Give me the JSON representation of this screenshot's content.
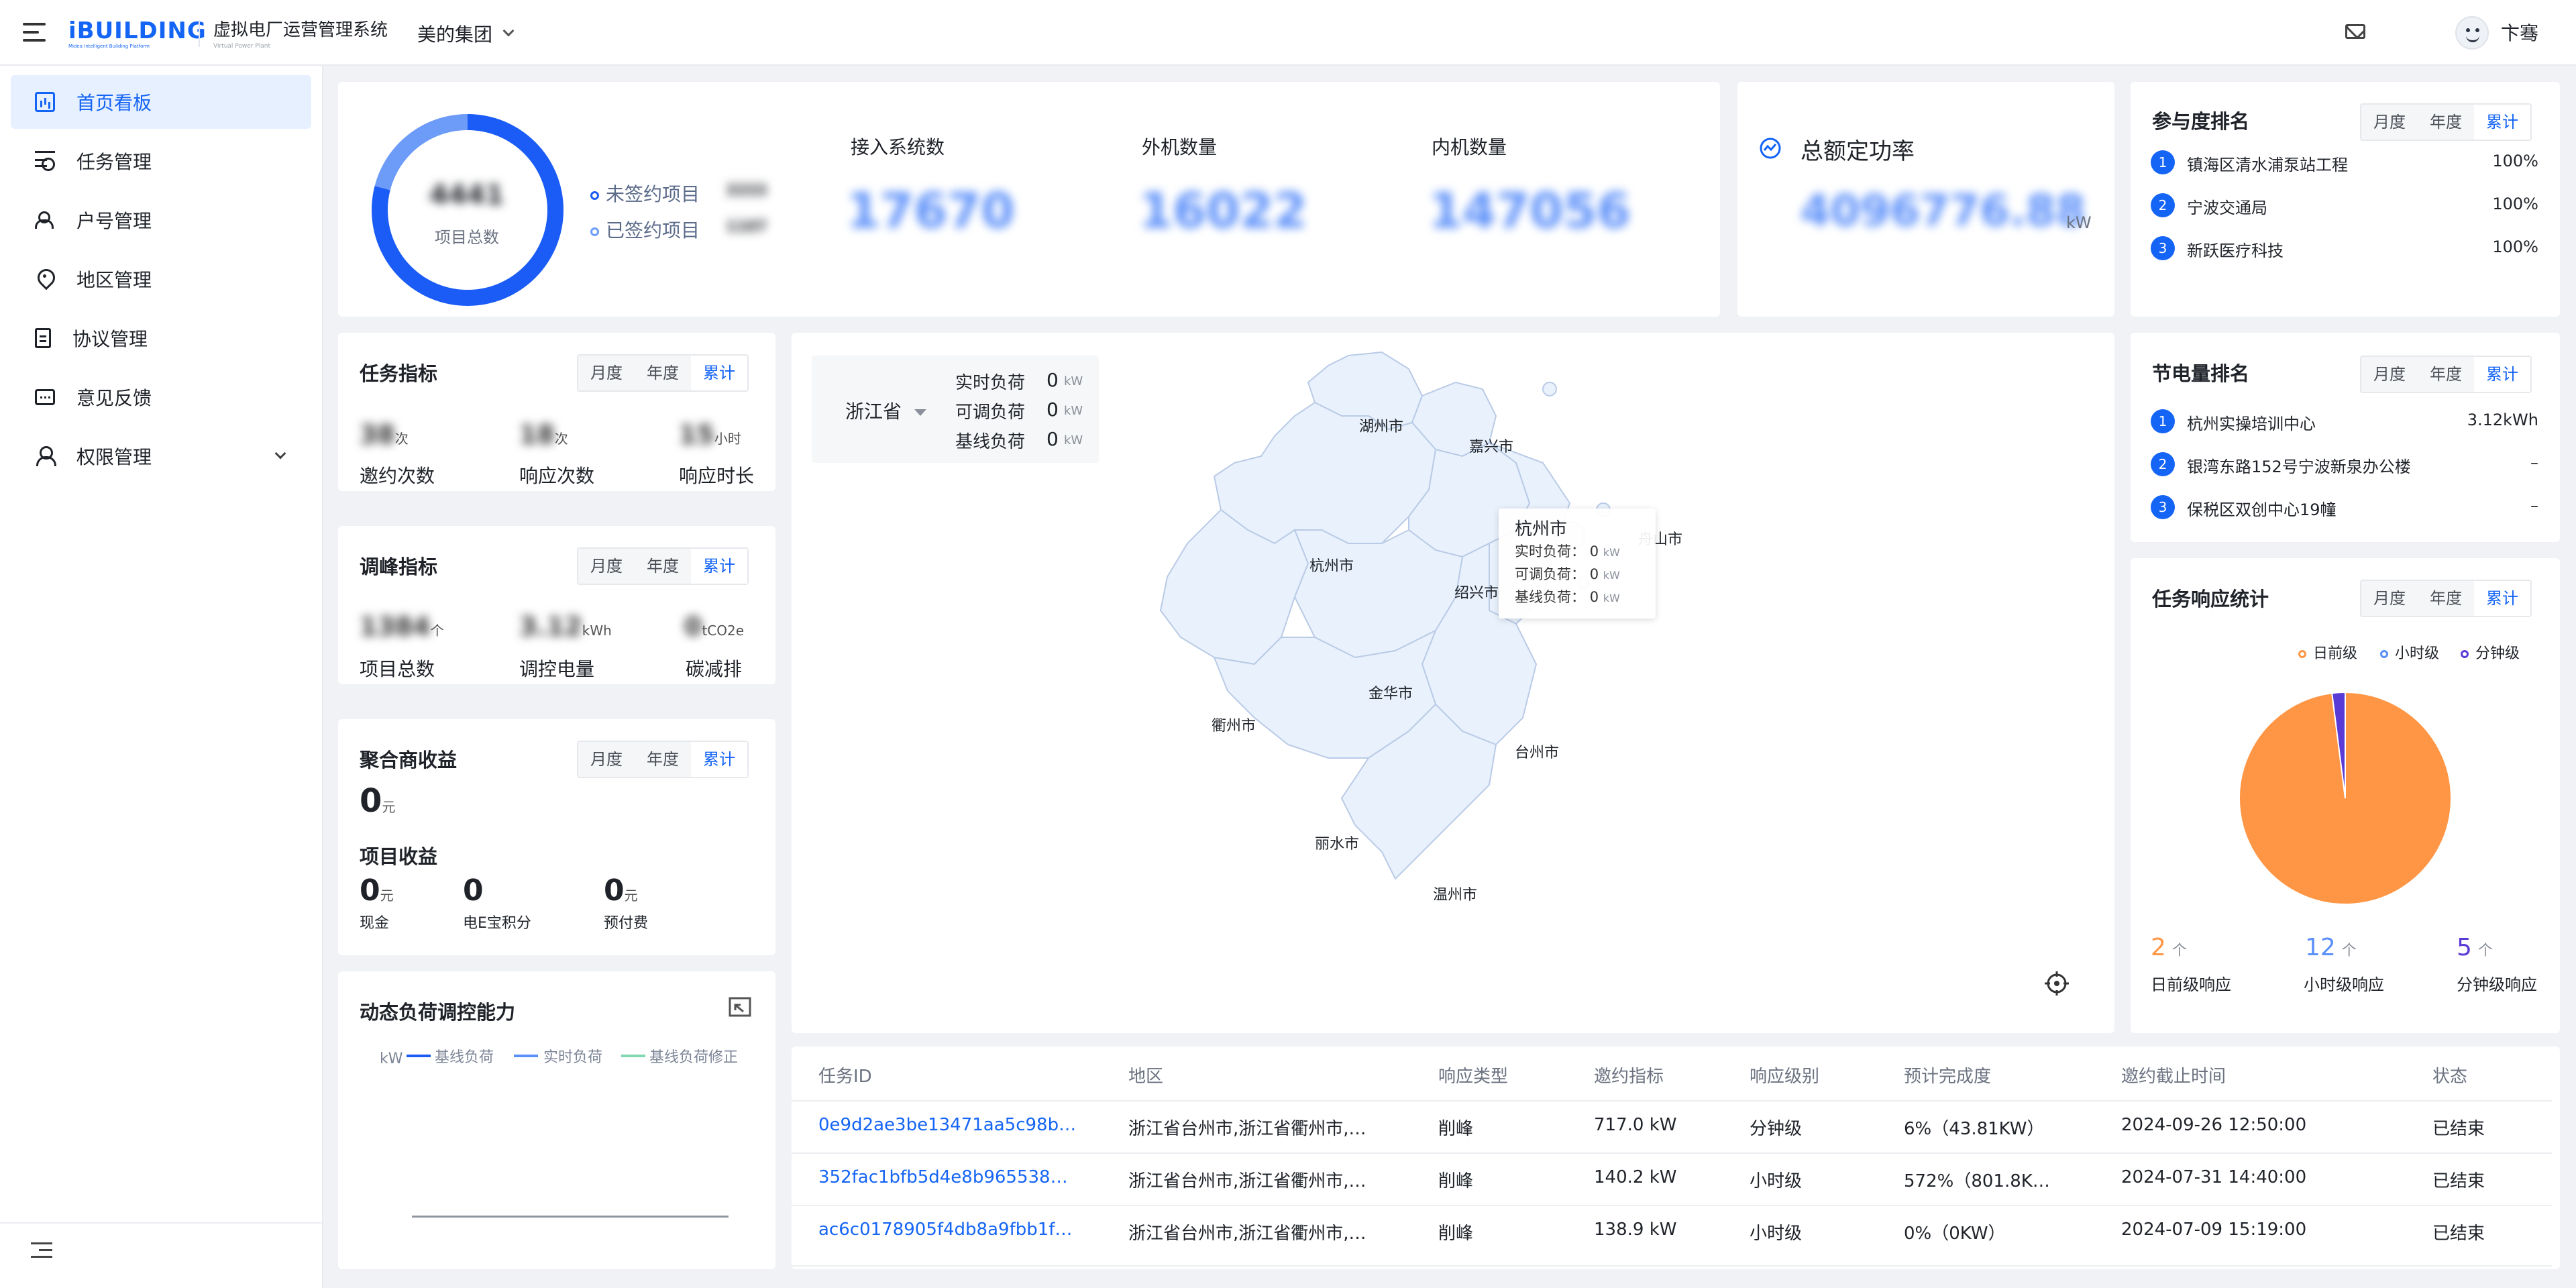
{
  "header": {
    "logo": "iBUILDING",
    "logo_tagline": "Midea Intelligent Building Platform",
    "system_name": "虚拟电厂运营管理系统",
    "system_name_en": "Virtual Power Plant",
    "group": "美的集团",
    "user": "卞骞"
  },
  "sidebar": {
    "items": [
      {
        "label": "首页看板",
        "icon": "dashboard-icon",
        "active": true
      },
      {
        "label": "任务管理",
        "icon": "task-icon"
      },
      {
        "label": "户号管理",
        "icon": "users-icon"
      },
      {
        "label": "地区管理",
        "icon": "location-pin-icon"
      },
      {
        "label": "协议管理",
        "icon": "document-icon"
      },
      {
        "label": "意见反馈",
        "icon": "feedback-icon"
      },
      {
        "label": "权限管理",
        "icon": "permission-icon"
      }
    ]
  },
  "segment": {
    "month": "月度",
    "year": "年度",
    "total": "累计"
  },
  "overview": {
    "donut_value": "4441",
    "donut_label": "项目总数",
    "unsigned_label": "未签约项目",
    "unsigned_value": "3333",
    "signed_label": "已签约项目",
    "signed_value": "1107",
    "donut_signed_fraction": 0.79,
    "stats": [
      {
        "label": "接入系统数",
        "value": "17670"
      },
      {
        "label": "外机数量",
        "value": "16022"
      },
      {
        "label": "内机数量",
        "value": "147056"
      }
    ]
  },
  "rated_power": {
    "title": "总额定功率",
    "value": "4096776.88",
    "unit": "kW"
  },
  "participation_rank": {
    "title": "参与度排名",
    "items": [
      {
        "rank": "1",
        "name": "镇海区清水浦泵站工程",
        "value": "100%"
      },
      {
        "rank": "2",
        "name": "宁波交通局",
        "value": "100%"
      },
      {
        "rank": "3",
        "name": "新跃医疗科技",
        "value": "100%"
      }
    ]
  },
  "energy_rank": {
    "title": "节电量排名",
    "items": [
      {
        "rank": "1",
        "name": "杭州实操培训中心",
        "value": "3.12kWh"
      },
      {
        "rank": "2",
        "name": "银湾东路152号宁波新泉办公楼",
        "value": "–"
      },
      {
        "rank": "3",
        "name": "保税区双创中心19幢",
        "value": "–"
      }
    ]
  },
  "task_metrics": {
    "title": "任务指标",
    "items": [
      {
        "value": "38",
        "unit": "次",
        "label": "邀约次数"
      },
      {
        "value": "18",
        "unit": "次",
        "label": "响应次数"
      },
      {
        "value": "15",
        "unit": "小时",
        "label": "响应时长"
      }
    ]
  },
  "peak_metrics": {
    "title": "调峰指标",
    "items": [
      {
        "value": "1384",
        "unit": "个",
        "label": "项目总数"
      },
      {
        "value": "3.12",
        "unit": "kWh",
        "label": "调控电量"
      },
      {
        "value": "0",
        "unit": "tCO2e",
        "label": "碳减排"
      }
    ]
  },
  "aggregator": {
    "title": "聚合商收益",
    "value": "0",
    "unit": "元",
    "project_title": "项目收益",
    "items": [
      {
        "value": "0",
        "unit": "元",
        "label": "现金"
      },
      {
        "value": "0",
        "unit": "",
        "label": "电E宝积分"
      },
      {
        "value": "0",
        "unit": "元",
        "label": "预付费"
      }
    ]
  },
  "dynamic_load": {
    "title": "动态负荷调控能力",
    "y_unit": "kW",
    "legend": [
      "基线负荷",
      "实时负荷",
      "基线负荷修正"
    ],
    "legend_colors": [
      "#1a5cf5",
      "#5b8ff9",
      "#7fd8b0"
    ]
  },
  "map": {
    "province": "浙江省",
    "realtime_label": "实时负荷",
    "adjustable_label": "可调负荷",
    "baseline_label": "基线负荷",
    "realtime": "0",
    "adjustable": "0",
    "baseline": "0",
    "unit": "kW",
    "cities": [
      "湖州市",
      "嘉兴市",
      "杭州市",
      "绍兴市",
      "舟山市",
      "衢州市",
      "金华市",
      "台州市",
      "丽水市",
      "温州市"
    ],
    "tooltip": {
      "city": "杭州市",
      "realtime": "0",
      "adjustable": "0",
      "baseline": "0"
    }
  },
  "response_stats": {
    "title": "任务响应统计",
    "legend": [
      "日前级",
      "小时级",
      "分钟级"
    ],
    "colors": [
      "#ff9645",
      "#5b8ff9",
      "#5b3bd6"
    ],
    "counts": [
      {
        "value": "2",
        "unit": "个",
        "label": "日前级响应"
      },
      {
        "value": "12",
        "unit": "个",
        "label": "小时级响应"
      },
      {
        "value": "5",
        "unit": "个",
        "label": "分钟级响应"
      }
    ],
    "chart_data": {
      "type": "pie",
      "categories": [
        "日前级",
        "小时级",
        "分钟级"
      ],
      "values": [
        98,
        0,
        2
      ]
    }
  },
  "table": {
    "headers": [
      "任务ID",
      "地区",
      "响应类型",
      "邀约指标",
      "响应级别",
      "预计完成度",
      "邀约截止时间",
      "状态"
    ],
    "rows": [
      [
        "0e9d2ae3be13471aa5c98b…",
        "浙江省台州市,浙江省衢州市,…",
        "削峰",
        "717.0 kW",
        "分钟级",
        "6%（43.81KW）",
        "2024-09-26 12:50:00",
        "已结束"
      ],
      [
        "352fac1bfb5d4e8b965538…",
        "浙江省台州市,浙江省衢州市,…",
        "削峰",
        "140.2 kW",
        "小时级",
        "572%（801.8K…",
        "2024-07-31 14:40:00",
        "已结束"
      ],
      [
        "ac6c0178905f4db8a9fbb1f…",
        "浙江省台州市,浙江省衢州市,…",
        "削峰",
        "138.9 kW",
        "小时级",
        "0%（0KW）",
        "2024-07-09 15:19:00",
        "已结束"
      ]
    ]
  }
}
